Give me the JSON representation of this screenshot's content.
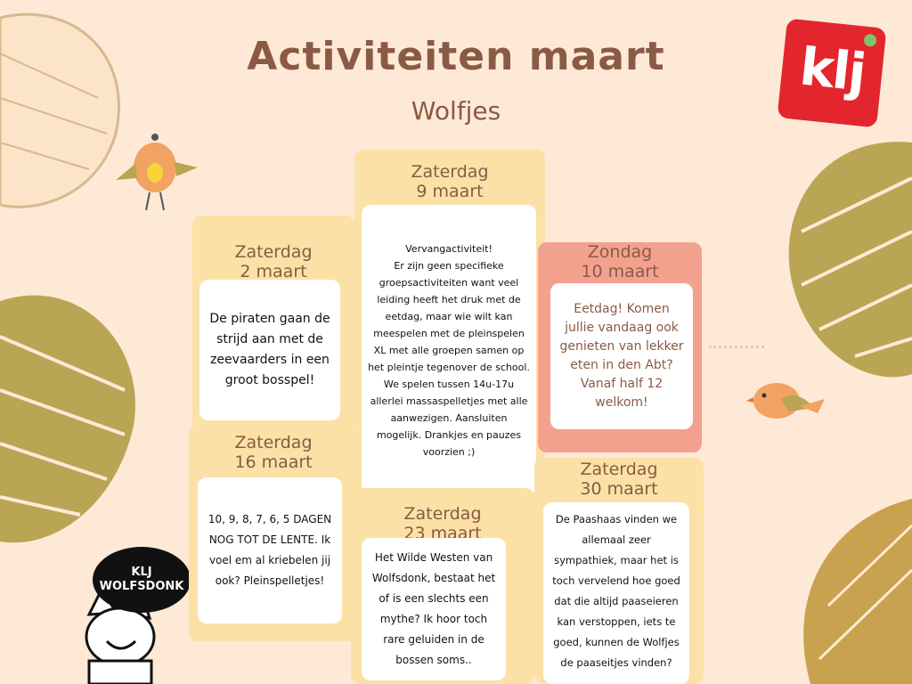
{
  "header": {
    "title": "Activiteiten maart",
    "subtitle": "Wolfjes"
  },
  "logo": {
    "text": "klj"
  },
  "badge": {
    "line1": "KLJ",
    "line2": "WOLFSDONK"
  },
  "colors": {
    "background": "#fde9d6",
    "panel": "#fbe1a6",
    "panel_highlight": "#f3a18f",
    "heading": "#8a5a44",
    "logo": "#e3262d",
    "leaf_olive": "#b9a553"
  },
  "activities": [
    {
      "day": "Zaterdag",
      "date": "2 maart",
      "text": "De piraten gaan de strijd aan met de zeevaarders in een groot bosspel!"
    },
    {
      "day": "Zaterdag",
      "date": "9 maart",
      "text": "Vervangactiviteit!\nEr zijn geen specifieke groepsactiviteiten want veel leiding heeft het druk met de eetdag, maar wie wilt kan meespelen met de pleinspelen XL met alle groepen samen op het pleintje tegenover de school. We spelen tussen 14u-17u allerlei massaspelletjes met alle aanwezigen. Aansluiten mogelijk.  Drankjes en pauzes voorzien ;)"
    },
    {
      "day": "Zondag",
      "date": "10 maart",
      "text": "Eetdag! Komen jullie vandaag ook genieten van lekker eten in den Abt? Vanaf half 12 welkom!"
    },
    {
      "day": "Zaterdag",
      "date": "16 maart",
      "text": "10, 9, 8, 7, 6, 5 DAGEN NOG TOT DE LENTE. Ik voel em al kriebelen jij ook? Pleinspelletjes!"
    },
    {
      "day": "Zaterdag",
      "date": "23 maart",
      "text": "Het Wilde Westen van Wolfsdonk, bestaat het of is een slechts een mythe? Ik hoor toch rare geluiden in de bossen soms.."
    },
    {
      "day": "Zaterdag",
      "date": "30 maart",
      "text": "De Paashaas vinden we allemaal zeer sympathiek, maar het is toch vervelend hoe goed dat die altijd paaseieren kan verstoppen, iets te goed, kunnen de Wolfjes de paaseitjes vinden?"
    }
  ],
  "icons": [
    "leaf-outline-icon",
    "leaf-olive-icon",
    "bird-icon",
    "fox-mascot-icon"
  ]
}
